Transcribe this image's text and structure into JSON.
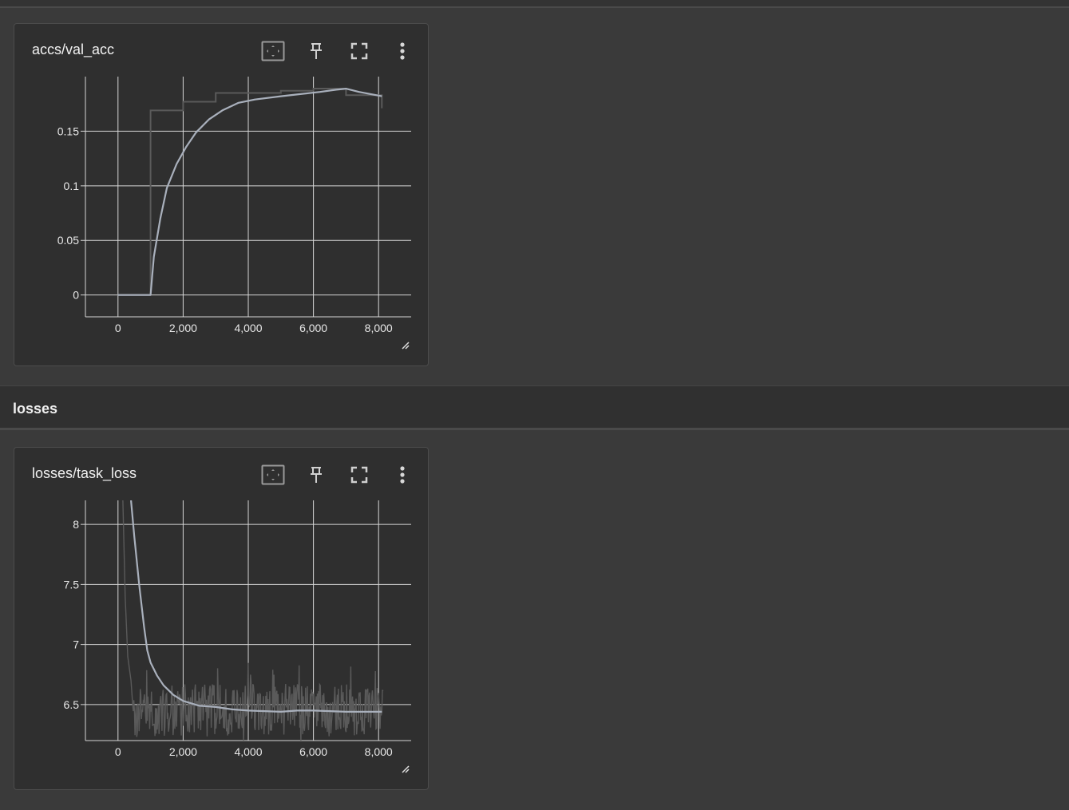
{
  "section": {
    "title": "losses"
  },
  "cards": [
    {
      "title": "accs/val_acc",
      "chart_data": {
        "type": "line",
        "title": "accs/val_acc",
        "xlim": [
          -1000,
          9000
        ],
        "ylim": [
          -0.02,
          0.2
        ],
        "x_ticks": [
          0,
          2000,
          4000,
          6000,
          8000
        ],
        "x_tick_labels": [
          "0",
          "2,000",
          "4,000",
          "6,000",
          "8,000"
        ],
        "y_ticks": [
          0,
          0.05,
          0.1,
          0.15
        ],
        "y_tick_labels": [
          "0",
          "0.05",
          "0.1",
          "0.15"
        ],
        "grid": true,
        "series": [
          {
            "role": "raw",
            "color": "#5a5a5a",
            "step": true,
            "x": [
              0,
              1000,
              1000,
              2000,
              3000,
              4000,
              5000,
              6000,
              7000,
              8000,
              8100
            ],
            "y": [
              0,
              0,
              0.169,
              0.177,
              0.185,
              0.185,
              0.187,
              0.189,
              0.183,
              0.183,
              0.171
            ]
          },
          {
            "role": "smoothed",
            "color": "#a9b0bc",
            "x": [
              0,
              1000,
              1100,
              1300,
              1500,
              1800,
              2100,
              2400,
              2800,
              3200,
              3700,
              4200,
              5000,
              5600,
              6200,
              6700,
              7000,
              7400,
              8100
            ],
            "y": [
              0,
              0,
              0.035,
              0.07,
              0.098,
              0.12,
              0.136,
              0.149,
              0.161,
              0.169,
              0.176,
              0.179,
              0.182,
              0.184,
              0.186,
              0.188,
              0.189,
              0.186,
              0.182
            ]
          }
        ]
      }
    },
    {
      "title": "losses/task_loss",
      "chart_data": {
        "type": "line",
        "title": "losses/task_loss",
        "xlim": [
          -1000,
          9000
        ],
        "ylim": [
          6.2,
          8.2
        ],
        "x_ticks": [
          0,
          2000,
          4000,
          6000,
          8000
        ],
        "x_tick_labels": [
          "0",
          "2,000",
          "4,000",
          "6,000",
          "8,000"
        ],
        "y_ticks": [
          6.5,
          7,
          7.5,
          8
        ],
        "y_tick_labels": [
          "6.5",
          "7",
          "7.5",
          "8"
        ],
        "grid": true,
        "series": [
          {
            "role": "raw",
            "color": "#5a5a5a",
            "noisy": true,
            "x_start": 150,
            "x_end": 8150,
            "base": 6.45,
            "noise": 0.22,
            "spikes": [
              [
                150,
                8.2
              ],
              [
                220,
                7.4
              ],
              [
                300,
                6.9
              ],
              [
                400,
                6.7
              ]
            ]
          },
          {
            "role": "smoothed",
            "color": "#a9b0bc",
            "x": [
              400,
              500,
              650,
              800,
              900,
              1000,
              1200,
              1400,
              1700,
              2000,
              2500,
              3000,
              3500,
              4000,
              5000,
              5500,
              6000,
              7000,
              8100
            ],
            "y": [
              8.2,
              7.9,
              7.5,
              7.15,
              6.95,
              6.85,
              6.74,
              6.66,
              6.58,
              6.53,
              6.49,
              6.48,
              6.46,
              6.45,
              6.44,
              6.45,
              6.45,
              6.44,
              6.44
            ]
          }
        ]
      }
    }
  ]
}
